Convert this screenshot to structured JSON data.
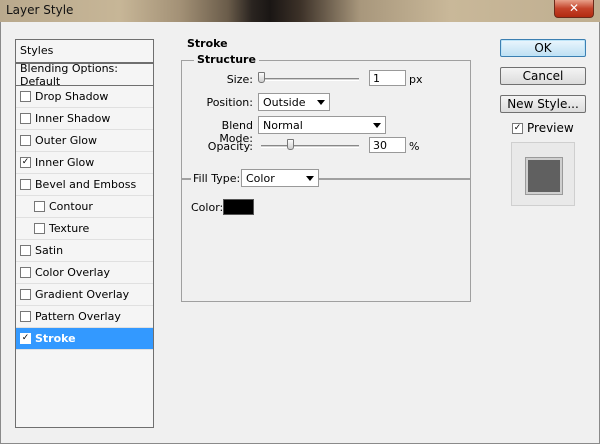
{
  "window": {
    "title": "Layer Style",
    "close_glyph": "✕"
  },
  "styles_panel": {
    "header": "Styles",
    "blending": "Blending Options: Default",
    "items": [
      {
        "label": "Drop Shadow",
        "checked": false,
        "indent": false,
        "selected": false
      },
      {
        "label": "Inner Shadow",
        "checked": false,
        "indent": false,
        "selected": false
      },
      {
        "label": "Outer Glow",
        "checked": false,
        "indent": false,
        "selected": false
      },
      {
        "label": "Inner Glow",
        "checked": true,
        "indent": false,
        "selected": false
      },
      {
        "label": "Bevel and Emboss",
        "checked": false,
        "indent": false,
        "selected": false
      },
      {
        "label": "Contour",
        "checked": false,
        "indent": true,
        "selected": false
      },
      {
        "label": "Texture",
        "checked": false,
        "indent": true,
        "selected": false
      },
      {
        "label": "Satin",
        "checked": false,
        "indent": false,
        "selected": false
      },
      {
        "label": "Color Overlay",
        "checked": false,
        "indent": false,
        "selected": false
      },
      {
        "label": "Gradient Overlay",
        "checked": false,
        "indent": false,
        "selected": false
      },
      {
        "label": "Pattern Overlay",
        "checked": false,
        "indent": false,
        "selected": false
      },
      {
        "label": "Stroke",
        "checked": true,
        "indent": false,
        "selected": true
      }
    ]
  },
  "stroke": {
    "title": "Stroke",
    "structure": {
      "title": "Structure",
      "size_label": "Size:",
      "size_value": "1",
      "size_unit": "px",
      "position_label": "Position:",
      "position_value": "Outside",
      "blend_label": "Blend Mode:",
      "blend_value": "Normal",
      "opacity_label": "Opacity:",
      "opacity_value": "30",
      "opacity_unit": "%"
    },
    "fill": {
      "type_label": "Fill Type:",
      "type_value": "Color",
      "color_label": "Color:",
      "color_hex": "#000000"
    }
  },
  "buttons": {
    "ok": "OK",
    "cancel": "Cancel",
    "new_style": "New Style...",
    "preview_label": "Preview",
    "preview_checked": true
  }
}
